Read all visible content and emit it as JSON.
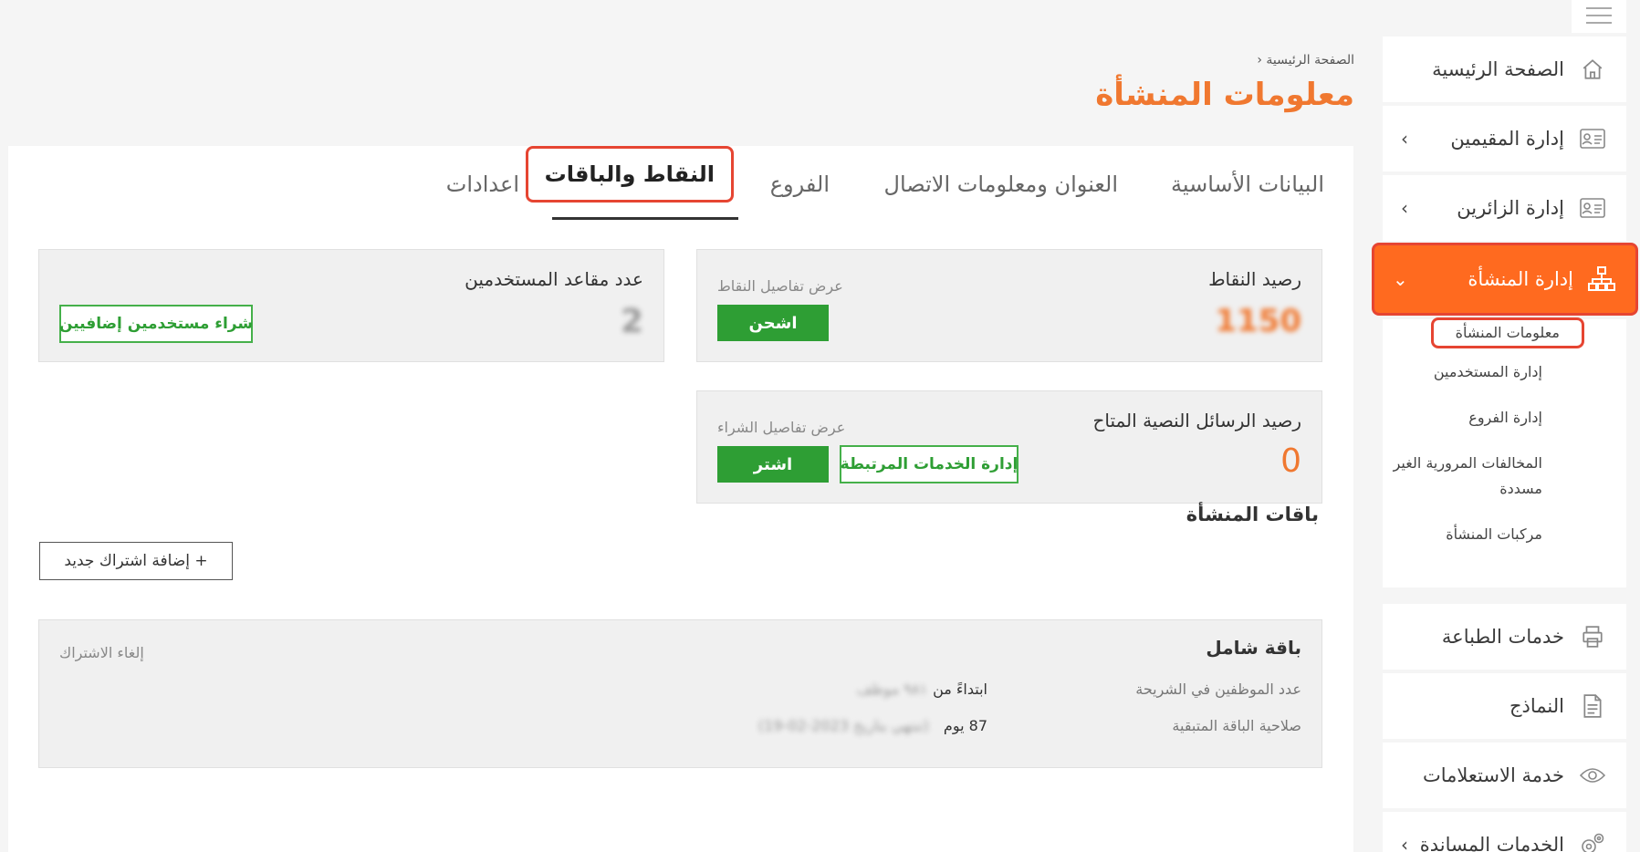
{
  "sidebar": {
    "items": [
      {
        "label": "الصفحة الرئيسية",
        "icon": "home-icon"
      },
      {
        "label": "إدارة المقيمين",
        "icon": "id-card-icon"
      },
      {
        "label": "إدارة الزائرين",
        "icon": "id-card-icon"
      },
      {
        "label": "إدارة المنشأة",
        "icon": "org-chart-icon"
      },
      {
        "label": "خدمات الطباعة",
        "icon": "printer-icon"
      },
      {
        "label": "النماذج",
        "icon": "document-icon"
      },
      {
        "label": "خدمة الاستعلامات",
        "icon": "eye-icon"
      },
      {
        "label": "الخدمات المساندة",
        "icon": "gears-icon"
      }
    ],
    "sub_items": [
      "معلومات المنشأة",
      "إدارة المستخدمين",
      "إدارة الفروع",
      "المخالفات المرورية الغير مسددة",
      "مركبات المنشأة"
    ]
  },
  "header": {
    "breadcrumb": "الصفحة الرئيسية",
    "title": "معلومات المنشأة"
  },
  "tabs": [
    "البيانات الأساسية",
    "العنوان ومعلومات الاتصال",
    "الفروع",
    "النقاط والباقات",
    "اعدادات"
  ],
  "cards": {
    "points": {
      "title": "رصيد النقاط",
      "value": "1150",
      "link": "عرض تفاصيل النقاط",
      "button": "اشحن"
    },
    "seats": {
      "title": "عدد مقاعد المستخدمين",
      "value": "2",
      "button": "شراء مستخدمين إضافيين"
    },
    "sms": {
      "title": "رصيد الرسائل النصية المتاح",
      "value": "0",
      "link": "عرض تفاصيل الشراء",
      "buy_button": "اشتر",
      "manage_button": "إدارة الخدمات المرتبطة"
    }
  },
  "packages": {
    "section_title": "باقات المنشأة",
    "add_button": "+ إضافة اشتراك جديد",
    "items": [
      {
        "name": "باقة شامل",
        "cancel": "إلغاء الاشتراك",
        "employees_label": "عدد الموظفين في الشريحة",
        "employees_prefix": "ابتداءً من",
        "employees_value": "٩٨١ موظف",
        "validity_label": "صلاحية الباقة المتبقية",
        "validity_value": "87 يوم",
        "validity_end": "(تنتهي بتاريخ 2023-02-19)"
      }
    ]
  },
  "colors": {
    "accent": "#f07830",
    "active_nav": "#ff6a1f",
    "highlight": "#e64532",
    "green": "#2e9e34"
  }
}
